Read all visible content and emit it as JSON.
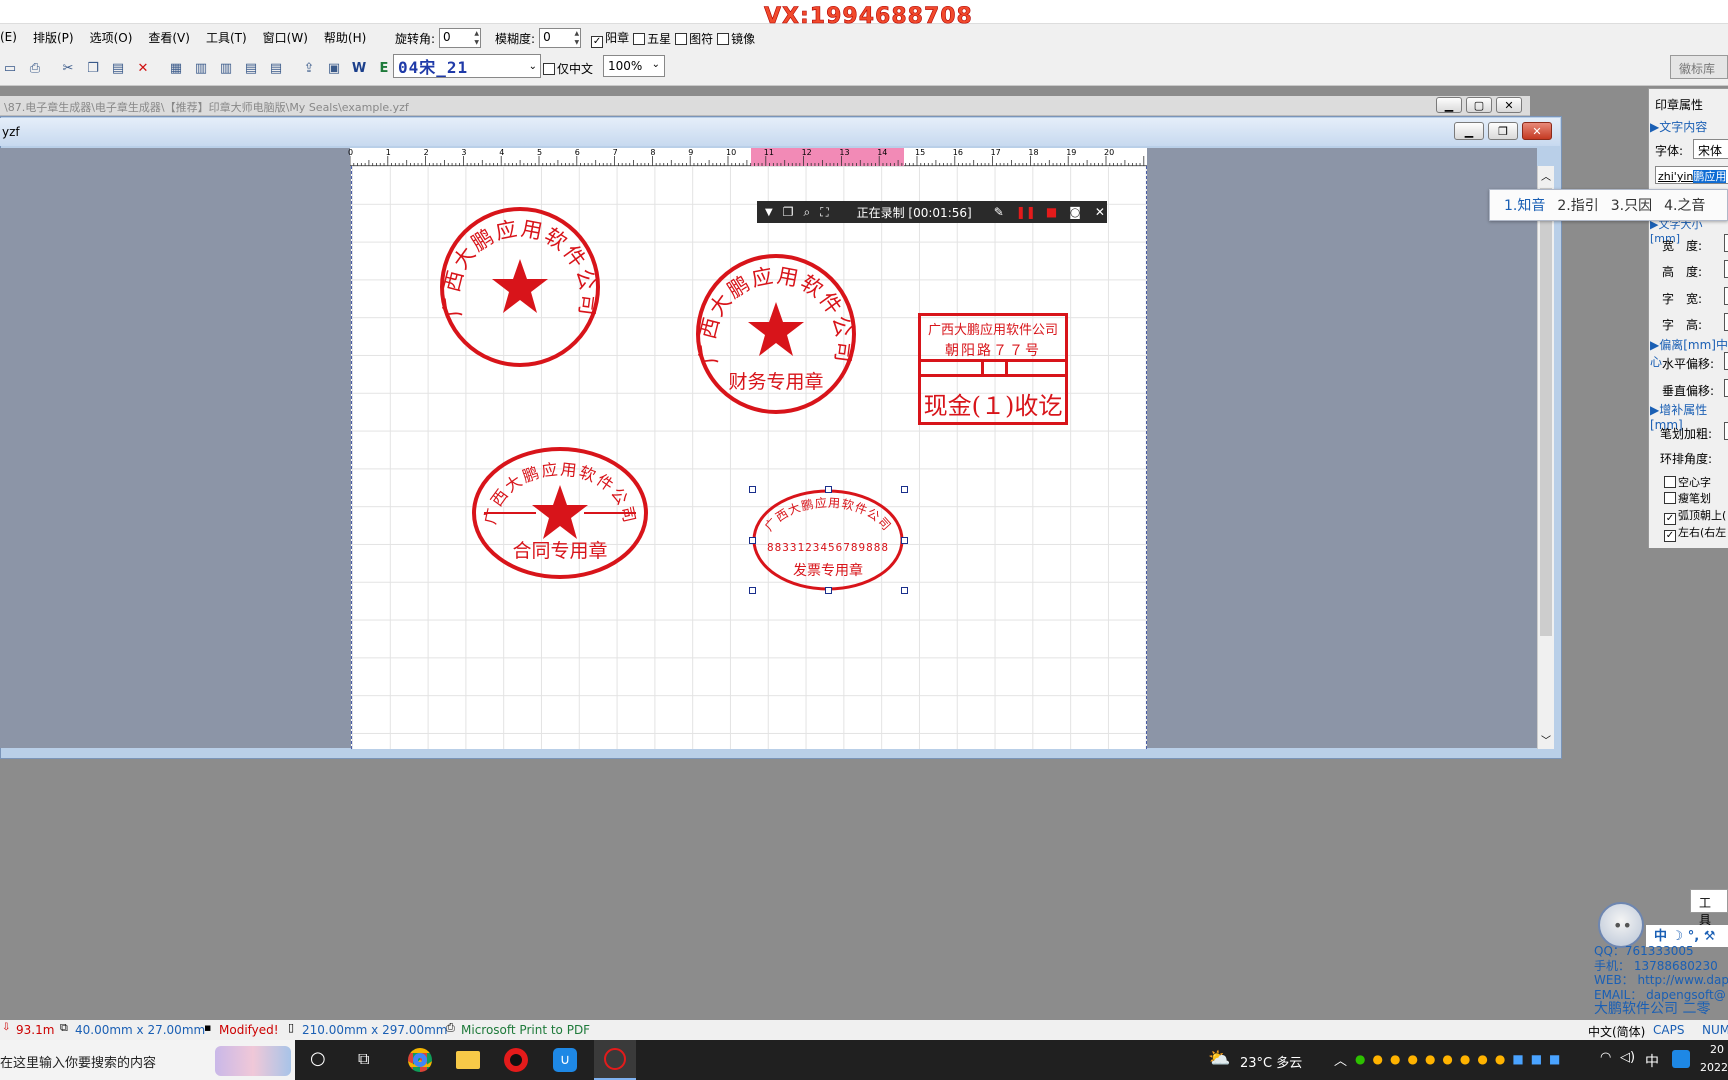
{
  "watermark": "VX:1994688708",
  "menu": [
    "(E)",
    "排版(P)",
    "选项(O)",
    "查看(V)",
    "工具(T)",
    "窗口(W)",
    "帮助(H)"
  ],
  "toolbar": {
    "rotate_label": "旋转角:",
    "rotate_value": "0",
    "blur_label": "模糊度:",
    "blur_value": "0",
    "yang_label": "阳章",
    "star_label": "五星",
    "symbol_label": "图符",
    "mirror_label": "镜像",
    "font_preview": "04宋_21",
    "chinese_only_label": "仅中文",
    "zoom": "100%",
    "logo_lib": "徽标库"
  },
  "outer_window": {
    "path": "\\87.电子章生成器\\电子章生成器\\【推荐】印章大师电脑版\\My Seals\\example.yzf"
  },
  "doc_window": {
    "title": "yzf"
  },
  "ruler": {
    "numbers": [
      "0",
      "1",
      "2",
      "3",
      "4",
      "5",
      "6",
      "7",
      "8",
      "9",
      "10",
      "11",
      "12",
      "13",
      "14",
      "15",
      "16",
      "17",
      "18",
      "19",
      "20"
    ]
  },
  "recorder": {
    "status": "正在录制 [00:01:56]"
  },
  "seals": {
    "seal1": {
      "company": "广西大鹏应用软件公司"
    },
    "seal2": {
      "company": "广西大鹏应用软件公司",
      "bottom": "财务专用章"
    },
    "seal3": {
      "line1": "广西大鹏应用软件公司",
      "line2": "朝阳路７７号",
      "bottom": "现金(１)收讫"
    },
    "seal4": {
      "company": "广西大鹏应用软件公司",
      "bottom": "合同专用章"
    },
    "seal5": {
      "company": "广西大鹏应用软件公司",
      "number": "8833123456789888",
      "bottom": "发票专用章"
    }
  },
  "panel": {
    "title": "印章属性",
    "text_content": "▶文字内容",
    "font_label": "字体:",
    "font_value": "宋体",
    "ime_input": "zhi'yin",
    "ime_selected": "鹏应用",
    "text_size_head": "▶文字大小[mm]",
    "width_label": "宽　度:",
    "height_label": "高　度:",
    "char_width_label": "字　宽:",
    "char_height_label": "字　高:",
    "offset_head": "▶偏离[mm]中心",
    "h_offset": "水平偏移:",
    "v_offset": "垂直偏移:",
    "extra_head": "▶增补属性[mm]",
    "stroke_label": "笔划加粗:",
    "ring_angle_label": "环排角度:",
    "hollow": "空心字",
    "thin": "瘦笔划",
    "arc_up": "弧顶朝上(",
    "lr": "左右(右左"
  },
  "ime_candidates": [
    "1.知音",
    "2.指引",
    "3.只因",
    "4.之音"
  ],
  "info": {
    "qq": "QQ：761333005",
    "phone": "手机： 13788680230",
    "web": "WEB： http://www.dap",
    "email": "EMAIL： dapengsoft@",
    "company": "大鹏软件公司 二零",
    "toolbox": "工具"
  },
  "status": {
    "s1": "93.1m",
    "size": "40.00mm x 27.00mm",
    "modified": "Modifyed!",
    "paper": "210.00mm x 297.00mm",
    "printer": "Microsoft Print to PDF",
    "ime": "中文(简体)",
    "caps": "CAPS",
    "num": "NUM"
  },
  "taskbar": {
    "search": "在这里输入你要搜索的内容",
    "weather": "23°C 多云",
    "ime": "中",
    "time": "20",
    "date": "2022"
  },
  "colors": {
    "seal_red": "#d8141a",
    "accent_blue": "#1a5fb4"
  }
}
